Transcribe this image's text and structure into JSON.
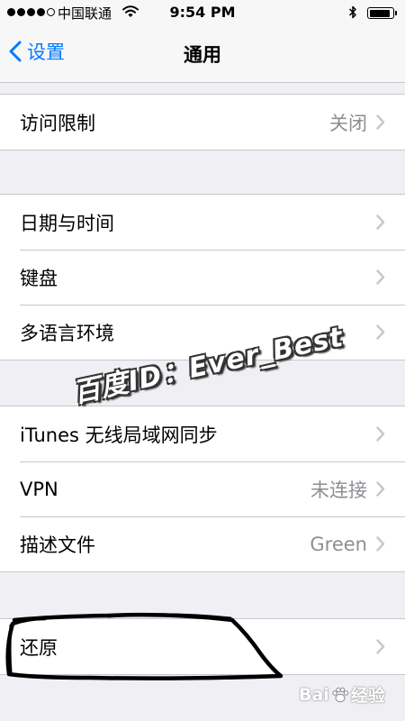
{
  "status_bar": {
    "carrier": "中国联通",
    "time": "9:54 PM",
    "signal_bars_filled": 4,
    "signal_bars_total": 5,
    "battery_level": 0.9
  },
  "nav_bar": {
    "back_label": "设置",
    "title": "通用"
  },
  "groups": [
    {
      "rows": [
        {
          "label": "访问限制",
          "value": "关闭"
        }
      ]
    },
    {
      "rows": [
        {
          "label": "日期与时间",
          "value": ""
        },
        {
          "label": "键盘",
          "value": ""
        },
        {
          "label": "多语言环境",
          "value": ""
        }
      ]
    },
    {
      "rows": [
        {
          "label": "iTunes 无线局域网同步",
          "value": ""
        },
        {
          "label": "VPN",
          "value": "未连接"
        },
        {
          "label": "描述文件",
          "value": "Green"
        }
      ]
    },
    {
      "rows": [
        {
          "label": "还原",
          "value": ""
        }
      ]
    }
  ],
  "watermark_text": "百度ID：Ever_Best",
  "brand_mark": {
    "left_text": "Bai",
    "right_text": "经验"
  },
  "colors": {
    "accent": "#007aff",
    "background": "#efeff4",
    "separator": "#c8c7cc",
    "secondary_text": "#8e8e93",
    "chevron": "#c7c7cc"
  }
}
